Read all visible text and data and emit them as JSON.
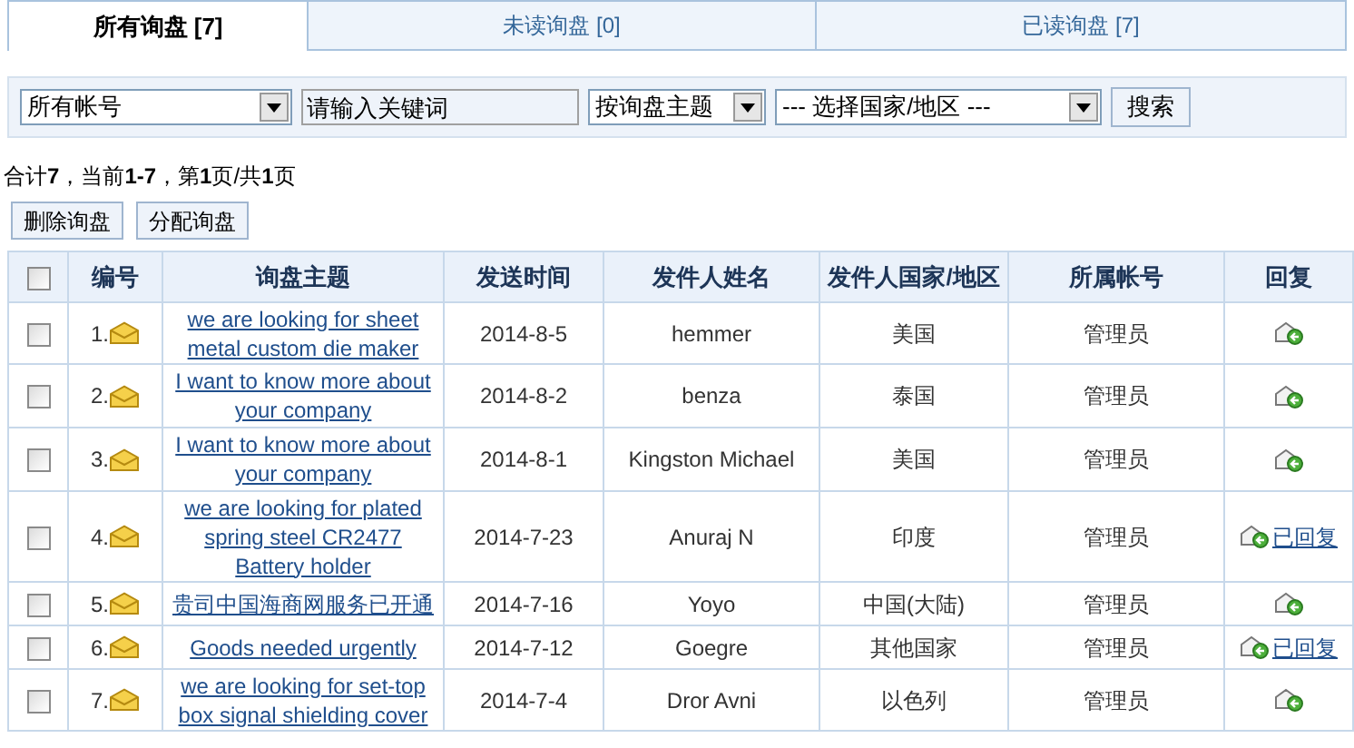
{
  "tabs": [
    {
      "label": "所有询盘 [7]",
      "selected": true
    },
    {
      "label": "未读询盘 [0]",
      "selected": false
    },
    {
      "label": "已读询盘 [7]",
      "selected": false
    }
  ],
  "filters": {
    "account": "所有帐号",
    "keyword_placeholder": "请输入关键词",
    "search_by": "按询盘主题",
    "country": "--- 选择国家/地区 ---",
    "search_button": "搜索"
  },
  "summary": "合计**7**，当前**1-7**，第**1**页/共**1**页",
  "actions": [
    "删除询盘",
    "分配询盘"
  ],
  "table": {
    "select_all_checked": false,
    "columns": [
      "编号",
      "询盘主题",
      "发送时间",
      "发件人姓名",
      "发件人国家/地区",
      "所属帐号",
      "回复"
    ],
    "rows": [
      {
        "checked": false,
        "number": "1.",
        "subject": "we are looking for sheet metal custom die maker",
        "time": "2014-8-5",
        "sender": "hemmer",
        "country": "美国",
        "account": "管理员"
      },
      {
        "checked": false,
        "number": "2.",
        "subject": "I want to know more about your company",
        "time": "2014-8-2",
        "sender": "benza",
        "country": "泰国",
        "account": "管理员"
      },
      {
        "checked": false,
        "number": "3.",
        "subject": "I want to know more about your company",
        "time": "2014-8-1",
        "sender": "Kingston Michael",
        "country": "美国",
        "account": "管理员"
      },
      {
        "checked": false,
        "number": "4.",
        "subject": "we are looking for plated spring steel CR2477 Battery holder",
        "time": "2014-7-23",
        "sender": "Anuraj N",
        "country": "印度",
        "account": "管理员",
        "reply_status": "已回复"
      },
      {
        "checked": false,
        "number": "5.",
        "subject": "贵司中国海商网服务已开通",
        "time": "2014-7-16",
        "sender": "Yoyo",
        "country": "中国(大陆)",
        "account": "管理员"
      },
      {
        "checked": false,
        "number": "6.",
        "subject": "Goods needed urgently",
        "time": "2014-7-12",
        "sender": "Goegre",
        "country": "其他国家",
        "account": "管理员",
        "reply_status": "已回复"
      },
      {
        "checked": false,
        "number": "7.",
        "subject": "we are looking for set-top box signal shielding cover",
        "time": "2014-7-4",
        "sender": "Dror Avni",
        "country": "以色列",
        "account": "管理员"
      }
    ]
  }
}
